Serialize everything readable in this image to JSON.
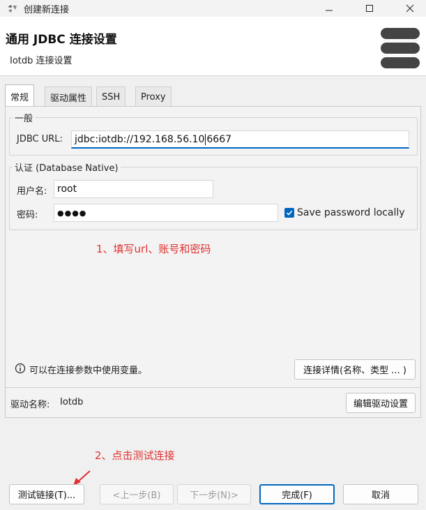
{
  "window": {
    "title": "创建新连接",
    "controls": [
      "—",
      "☐",
      "✕"
    ]
  },
  "header": {
    "title": "通用 JDBC 连接设置",
    "subtitle": "Iotdb 连接设置"
  },
  "tabs": [
    "常规",
    "驱动属性",
    "SSH",
    "Proxy"
  ],
  "general": {
    "group_label": "一般",
    "url_label": "JDBC URL:",
    "url_before_caret": "jdbc:iotdb://192.168.56.10",
    "url_after_caret": "6667"
  },
  "auth": {
    "group_label": "认证 (Database Native)",
    "user_label": "用户名:",
    "user_value": "root",
    "password_label": "密码:",
    "password_masked": "●●●●",
    "save_password_label": "Save password locally",
    "save_password_checked": true
  },
  "annotations": {
    "step1": "1、填写url、账号和密码",
    "step2": "2、点击测试连接",
    "color": "#e03131"
  },
  "info": {
    "text": "可以在连接参数中使用变量。",
    "details_button": "连接详情(名称、类型 ... )"
  },
  "driver": {
    "label": "驱动名称:",
    "value": "Iotdb",
    "edit_button": "编辑驱动设置"
  },
  "footer": {
    "test": "测试链接(T)...",
    "back": "<上一步(B)",
    "next": "下一步(N)>",
    "finish": "完成(F)",
    "cancel": "取消"
  },
  "colors": {
    "accent": "#0067c0",
    "annotation": "#e03131"
  }
}
